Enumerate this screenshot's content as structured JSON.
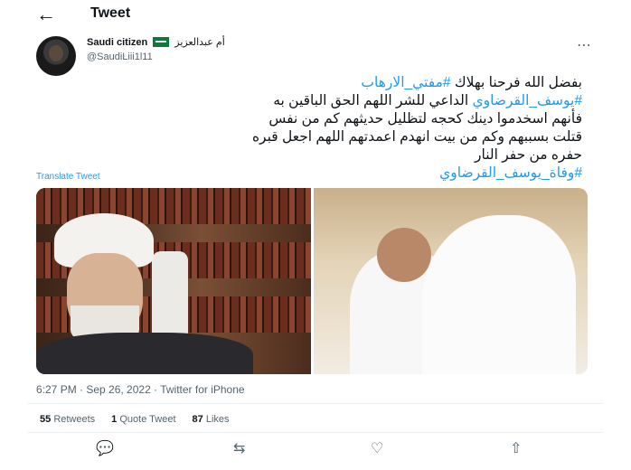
{
  "header": {
    "back_icon": "arrow-left-icon",
    "title": "Tweet"
  },
  "author": {
    "name": "Saudi citizen",
    "arabic_name": "أم عبدالعزيز",
    "handle": "@SaudiLiii1l11",
    "flag_icon": "saudi-flag-icon"
  },
  "tweet": {
    "line1_text": "بفضل الله فرحنا بهلاك ",
    "line1_tag": "#مفتي_الارهاب",
    "line2_tag": "#يوسف_القرضاوي",
    "line2_text": " الداعي للشر اللهم الحق الباقين به",
    "line3": "فأنهم اسخدموا دينك كحجه لتظليل حديثهم كم من نفس",
    "line4": "قتلت بسببهم وكم من بيت انهدم اعمدتهم  اللهم اجعل قبره",
    "line5": "حفره من حفر النار",
    "line6_tag": "#وفاة_يوسف_القرضاوي"
  },
  "translate_label": "Translate Tweet",
  "meta": "6:27 PM · Sep 26, 2022 · Twitter for iPhone",
  "stats": {
    "retweets_count": "55",
    "retweets_label": "Retweets",
    "quotes_count": "1",
    "quotes_label": "Quote Tweet",
    "likes_count": "87",
    "likes_label": "Likes"
  },
  "colors": {
    "link": "#1d9bf0",
    "muted": "#536471"
  }
}
